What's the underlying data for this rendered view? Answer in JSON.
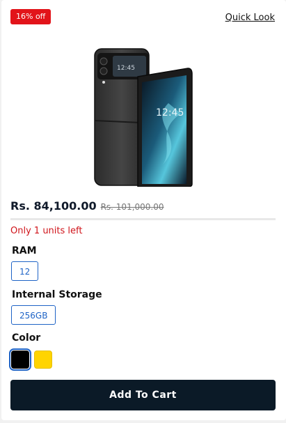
{
  "badge": {
    "discount_text": "16% off"
  },
  "quick_look_label": "Quick Look",
  "product": {
    "image_alt": "Samsung Galaxy Z Flip phone",
    "screen_time": "12:45",
    "price_current": "Rs. 84,100.00",
    "price_old": "Rs. 101,000.00",
    "stock_text": "Only 1 units left"
  },
  "ram": {
    "label": "RAM",
    "options": [
      "12"
    ],
    "selected": "12"
  },
  "storage": {
    "label": "Internal Storage",
    "options": [
      "256GB"
    ],
    "selected": "256GB"
  },
  "color": {
    "label": "Color",
    "swatches": [
      "#000000",
      "#ffd400"
    ],
    "selected_index": 0
  },
  "cart_button_label": "Add To Cart",
  "colors": {
    "accent": "#1e63c6",
    "sale": "#e2141a",
    "button_bg": "#0b1a27"
  }
}
